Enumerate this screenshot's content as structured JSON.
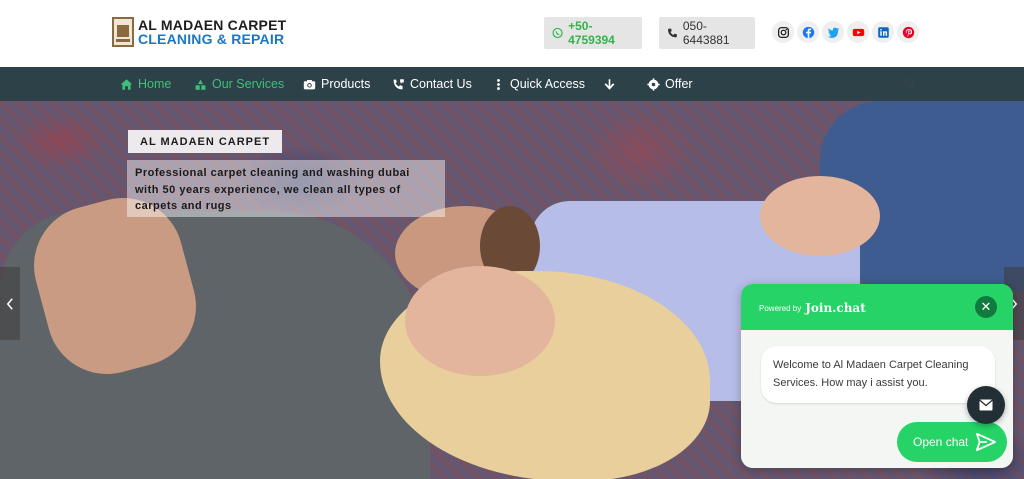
{
  "header": {
    "logo_line1": "AL MADAEN CARPET",
    "logo_line2": "CLEANING & REPAIR",
    "whatsapp_number": "+50-4759394",
    "phone_number": "050-6443881",
    "socials": [
      "instagram-icon",
      "facebook-icon",
      "twitter-icon",
      "youtube-icon",
      "linkedin-icon",
      "pinterest-icon"
    ]
  },
  "nav": {
    "items": [
      {
        "label": "Home",
        "icon": "home-icon",
        "active": true
      },
      {
        "label": "Our Services",
        "icon": "services-icon",
        "active": true
      },
      {
        "label": "Products",
        "icon": "camera-icon",
        "active": false
      },
      {
        "label": "Contact Us",
        "icon": "contact-icon",
        "active": false
      },
      {
        "label": "Quick Access",
        "icon": "vertical-dots-icon",
        "active": false
      },
      {
        "label": "",
        "icon": "arrow-down-icon",
        "active": false
      },
      {
        "label": "Offer",
        "icon": "gear-icon",
        "active": false
      }
    ]
  },
  "hero": {
    "badge": "AL MADAEN CARPET",
    "description": "Professional carpet cleaning and washing dubai with 50 years experience, we clean all types of carpets and rugs"
  },
  "chat": {
    "powered_by": "Powered by",
    "brand": "Join.chat",
    "message": "Welcome to Al Madaen Carpet Cleaning Services. How may i assist you.",
    "open_label": "Open chat"
  },
  "colors": {
    "nav_bg": "#2d4149",
    "accent_green": "#3dc17a",
    "whatsapp_green": "#25d366",
    "logo_blue": "#1a78c2"
  }
}
